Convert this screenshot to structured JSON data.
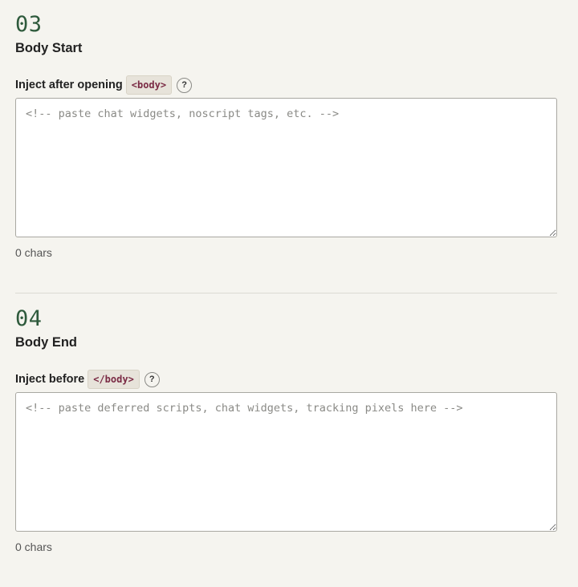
{
  "sections": [
    {
      "number": "03",
      "title": "Body Start",
      "label": "Inject after opening",
      "tag": "<body>",
      "help_label": "?",
      "textarea_value": "",
      "textarea_placeholder": "<!-- paste chat widgets, noscript tags, etc. -->",
      "char_count": "0 chars"
    },
    {
      "number": "04",
      "title": "Body End",
      "label": "Inject before",
      "tag": "</body>",
      "help_label": "?",
      "textarea_value": "",
      "textarea_placeholder": "<!-- paste deferred scripts, chat widgets, tracking pixels here -->",
      "char_count": "0 chars"
    }
  ],
  "colors": {
    "background": "#f5f4ef",
    "section_number": "#2e5a3c",
    "tag_text": "#7a2a44",
    "tag_background": "#e7e3da"
  }
}
